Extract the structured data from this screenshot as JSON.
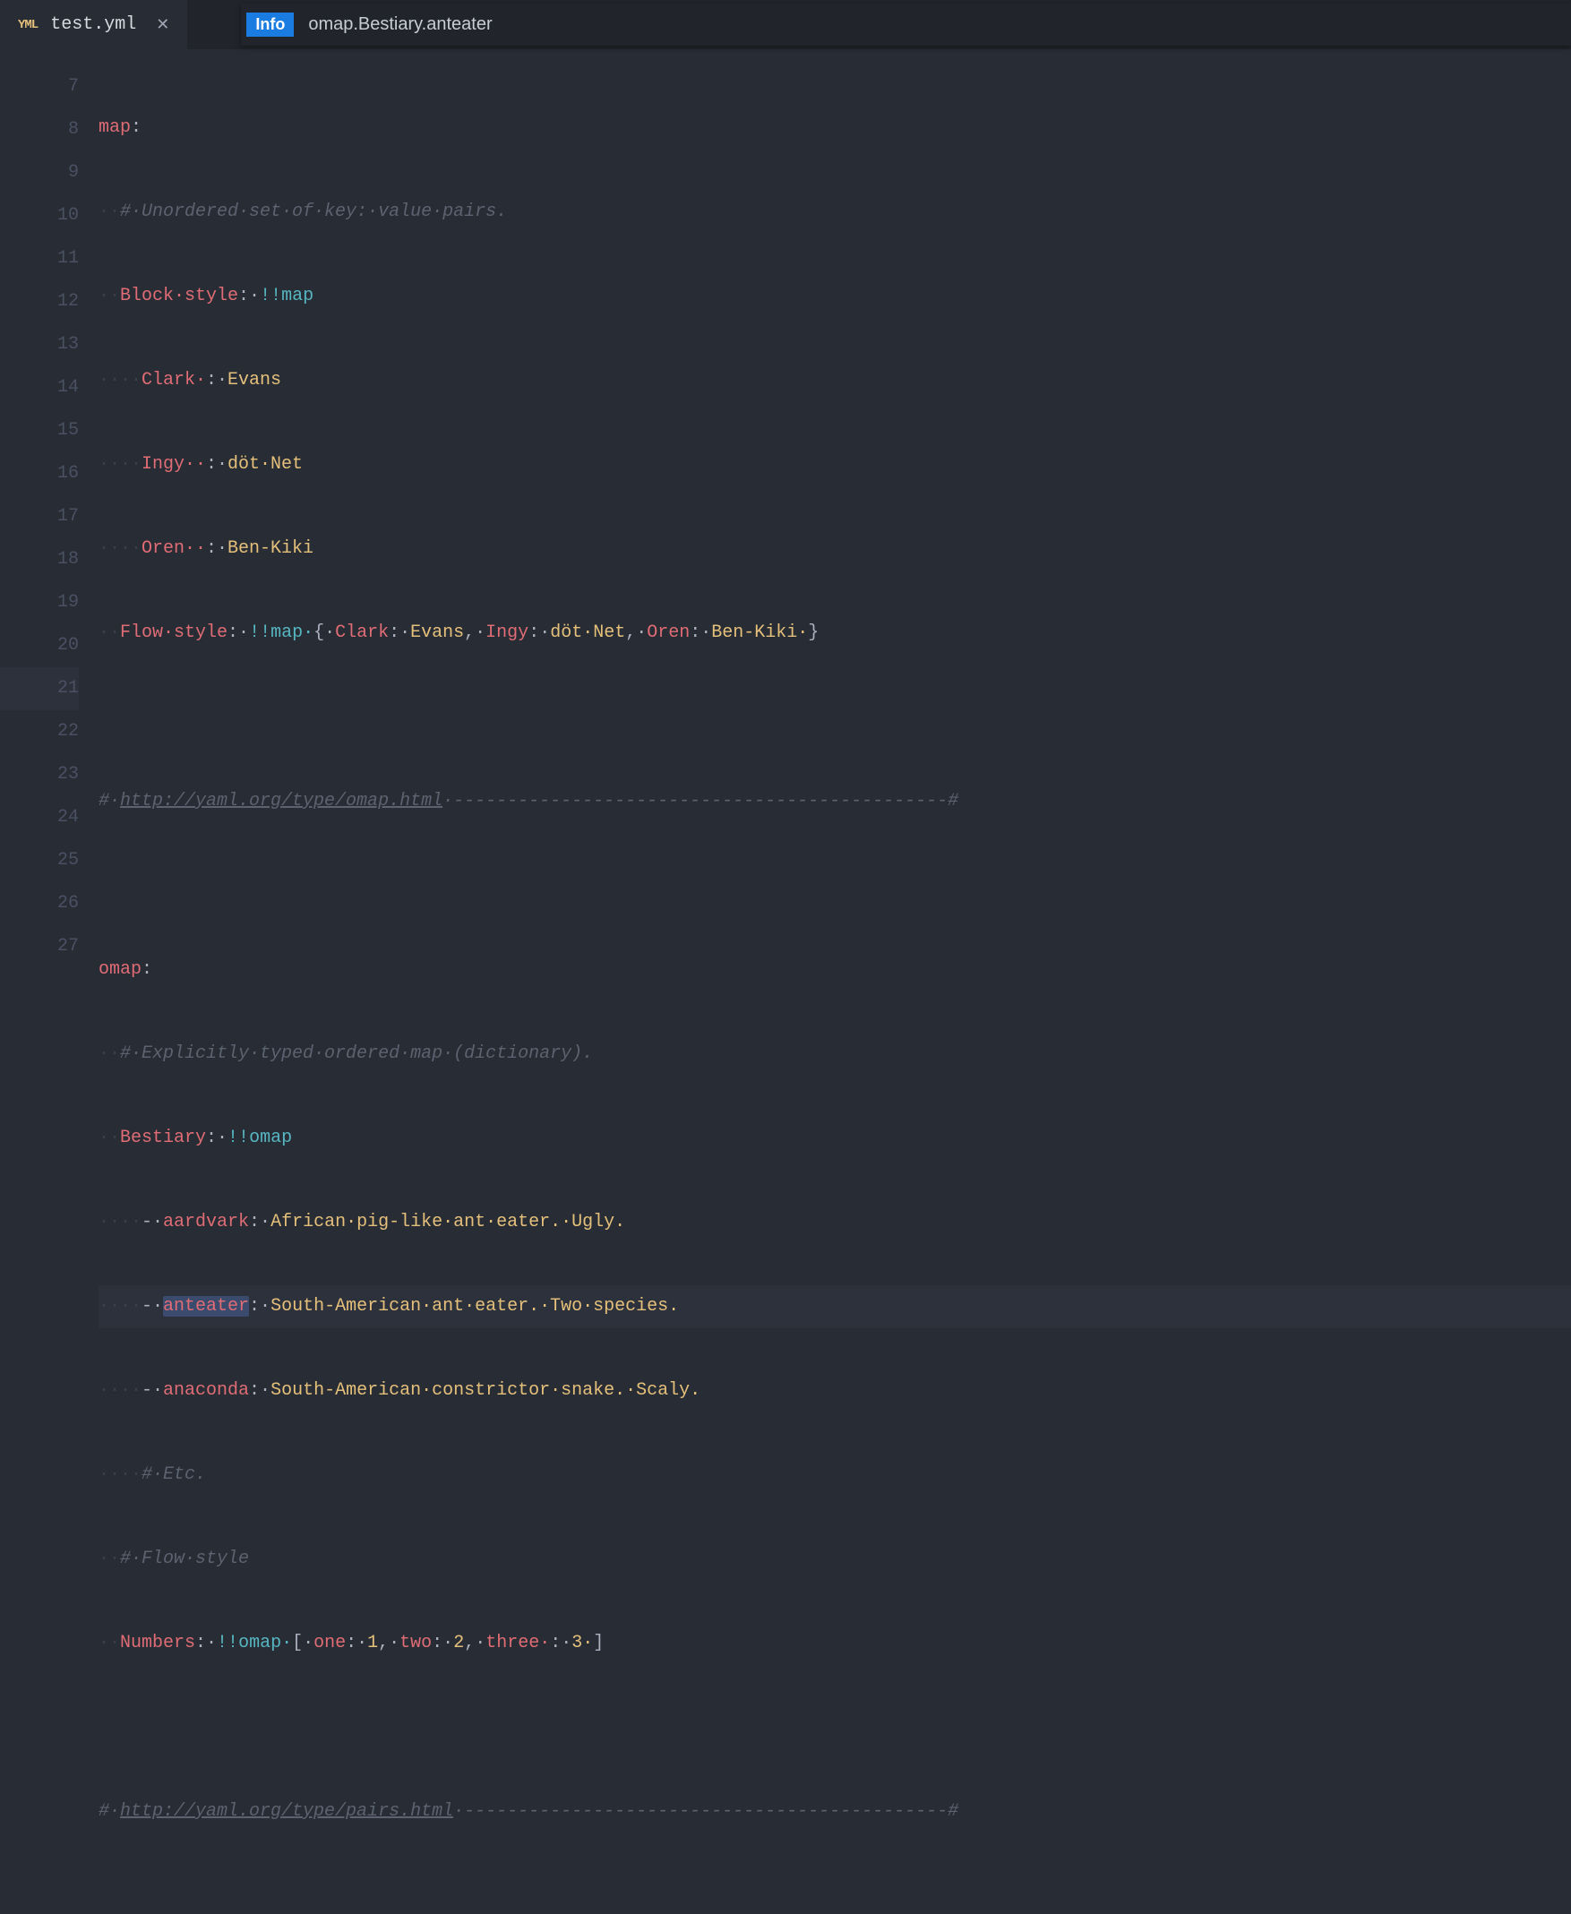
{
  "tabbar": {
    "file_icon": "YML",
    "filename": "test.yml",
    "close_glyph": "✕",
    "info_chip": "Info",
    "breadcrumb": "omap.Bestiary.anteater"
  },
  "gutter": {
    "start": 7,
    "end": 27
  },
  "code": {
    "l7": {
      "key": "map",
      "colon": ":"
    },
    "l8": {
      "ws": "··",
      "comment": "#·Unordered·set·of·key:·value·pairs."
    },
    "l9": {
      "ws": "··",
      "key": "Block·style",
      "colon": ":·",
      "tag": "!!",
      "tagname": "map"
    },
    "l10": {
      "ws": "····",
      "key": "Clark·",
      "colon": ":·",
      "val": "Evans"
    },
    "l11": {
      "ws": "····",
      "key": "Ingy··",
      "colon": ":·",
      "val": "döt·Net"
    },
    "l12": {
      "ws": "····",
      "key": "Oren··",
      "colon": ":·",
      "val": "Ben-Kiki"
    },
    "l13": {
      "ws": "··",
      "key": "Flow·style",
      "colon": ":·",
      "tag": "!!",
      "tagname": "map·",
      "open": "{·",
      "k1": "Clark",
      "c1": ":·",
      "v1": "Evans",
      "s1": ",·",
      "k2": "Ingy",
      "c2": ":·",
      "v2": "döt·Net",
      "s2": ",·",
      "k3": "Oren",
      "c3": ":·",
      "v3": "Ben-Kiki·",
      "close": "}"
    },
    "l15": {
      "hash": "#·",
      "url": "http://yaml.org/type/omap.html",
      "dash": "·----------------------------------------------#"
    },
    "l17": {
      "key": "omap",
      "colon": ":"
    },
    "l18": {
      "ws": "··",
      "comment": "#·Explicitly·typed·ordered·map·(dictionary)."
    },
    "l19": {
      "ws": "··",
      "key": "Bestiary",
      "colon": ":·",
      "tag": "!!",
      "tagname": "omap"
    },
    "l20": {
      "ws": "····",
      "dash": "-·",
      "key": "aardvark",
      "colon": ":·",
      "val": "African·pig-like·ant·eater.·Ugly."
    },
    "l21": {
      "ws": "····",
      "dash": "-·",
      "key": "anteater",
      "colon": ":·",
      "val": "South-American·ant·eater.·Two·species."
    },
    "l22": {
      "ws": "····",
      "dash": "-·",
      "key": "anaconda",
      "colon": ":·",
      "val": "South-American·constrictor·snake.·Scaly."
    },
    "l23": {
      "ws": "····",
      "comment": "#·Etc."
    },
    "l24": {
      "ws": "··",
      "comment": "#·Flow·style"
    },
    "l25": {
      "ws": "··",
      "key": "Numbers",
      "colon": ":·",
      "tag": "!!",
      "tagname": "omap·",
      "open": "[·",
      "k1": "one",
      "c1": ":·",
      "v1": "1",
      "s1": ",·",
      "k2": "two",
      "c2": ":·",
      "v2": "2",
      "s2": ",·",
      "k3": "three·",
      "c3": ":·",
      "v3": "3·",
      "close": "]"
    },
    "l27": {
      "hash": "#·",
      "url": "http://yaml.org/type/pairs.html",
      "dash": "·---------------------------------------------#"
    }
  }
}
